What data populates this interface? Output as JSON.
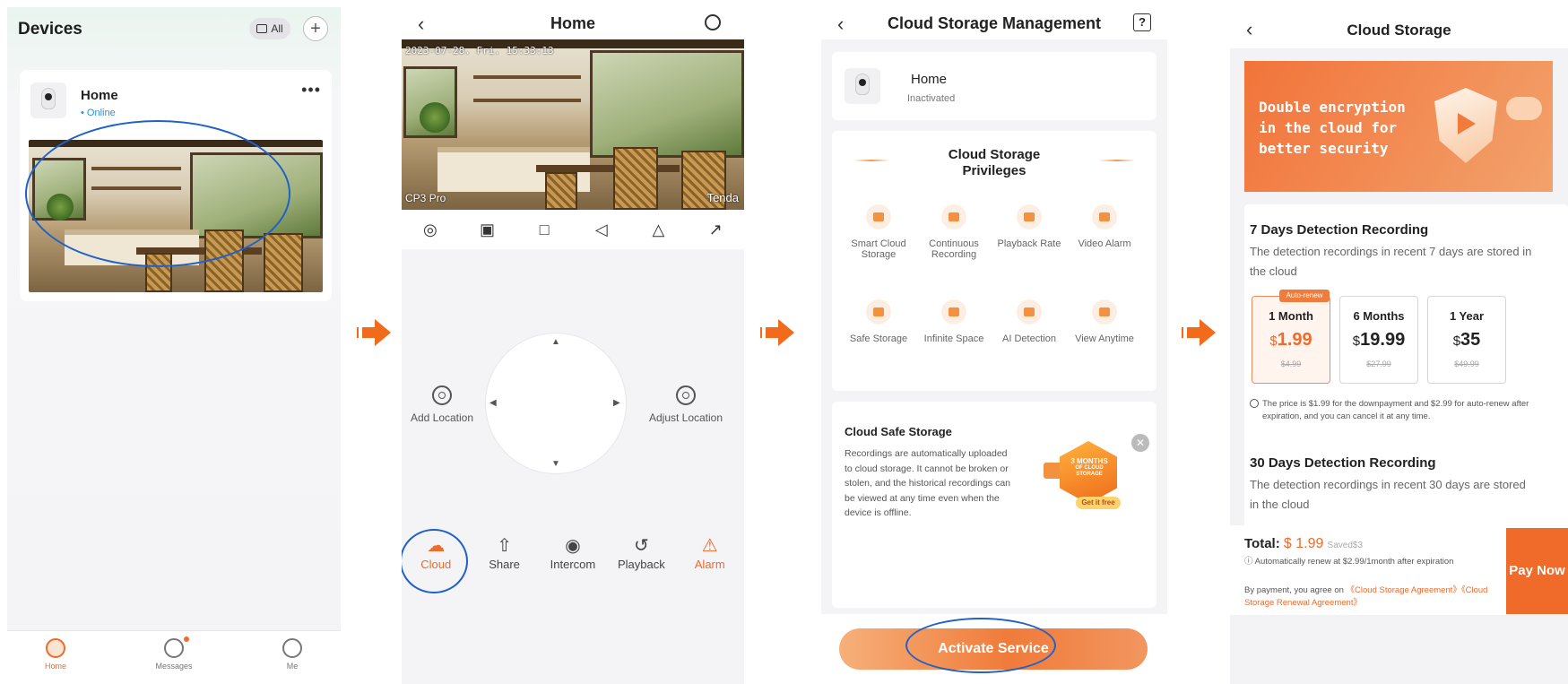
{
  "colors": {
    "accent": "#f06a2a",
    "online": "#2d8fdc",
    "highlight_ellipse": "#1f61c6"
  },
  "screen1": {
    "title": "Devices",
    "filter_label": "All",
    "device": {
      "name": "Home",
      "status": "• Online"
    },
    "tabs": [
      {
        "label": "Home",
        "icon": "home-camera-icon",
        "active": true
      },
      {
        "label": "Messages",
        "icon": "chat-icon",
        "active": false
      },
      {
        "label": "Me",
        "icon": "person-icon",
        "active": false
      }
    ]
  },
  "screen2": {
    "title": "Home",
    "timestamp": "2023-07-28. Fri.   15:33:13",
    "model": "CP3 Pro",
    "brand": "Tenda",
    "ptz_left": {
      "label": "Add Location"
    },
    "ptz_right": {
      "label": "Adjust Location"
    },
    "actions": [
      {
        "label": "Cloud",
        "icon": "cloud-icon",
        "color": "#f06a2a"
      },
      {
        "label": "Share",
        "icon": "share-icon",
        "color": "#444444"
      },
      {
        "label": "Intercom",
        "icon": "microphone-icon",
        "color": "#444444"
      },
      {
        "label": "Playback",
        "icon": "playback-icon",
        "color": "#444444"
      },
      {
        "label": "Alarm",
        "icon": "alarm-icon",
        "color": "#f06a2a"
      }
    ]
  },
  "screen3": {
    "title": "Cloud Storage Management",
    "device": {
      "name": "Home",
      "status": "Inactivated"
    },
    "privileges_title": "Cloud Storage Privileges",
    "privileges": [
      {
        "label": "Smart Cloud Storage",
        "icon": "cloud-storage-icon"
      },
      {
        "label": "Continuous Recording",
        "icon": "video-record-icon"
      },
      {
        "label": "Playback Rate",
        "icon": "fast-forward-icon"
      },
      {
        "label": "Video Alarm",
        "icon": "video-alarm-icon"
      },
      {
        "label": "Safe Storage",
        "icon": "shield-icon"
      },
      {
        "label": "Infinite Space",
        "icon": "box-icon"
      },
      {
        "label": "AI Detection",
        "icon": "ai-detection-icon"
      },
      {
        "label": "View Anytime",
        "icon": "view-icon"
      }
    ],
    "safe_title": "Cloud Safe Storage",
    "safe_text": "Recordings are automatically uploaded to cloud storage. It cannot be broken or stolen, and the historical recordings can be viewed at any time even when the device is offline.",
    "promo": {
      "line1": "3 MONTHS",
      "line2": "OF CLOUD STORAGE",
      "button": "Get it free"
    },
    "activate_label": "Activate Service"
  },
  "screen4": {
    "title": "Cloud Storage",
    "banner_text": "Double encryption in the cloud for better security",
    "section1": {
      "title": "7 Days Detection Recording",
      "desc": "The detection recordings in recent 7 days are stored in the cloud"
    },
    "plans": [
      {
        "tag": "Auto-renew",
        "duration": "1 Month",
        "currency": "$",
        "price": "1.99",
        "original": "$4.99",
        "selected": true
      },
      {
        "tag": "",
        "duration": "6 Months",
        "currency": "$",
        "price": "19.99",
        "original": "$27.99",
        "selected": false
      },
      {
        "tag": "",
        "duration": "1 Year",
        "currency": "$",
        "price": "35",
        "original": "$49.99",
        "selected": false
      }
    ],
    "note": "The price is $1.99 for the downpayment and $2.99 for auto-renew after expiration, and you can cancel it at any time.",
    "section2": {
      "title": "30 Days Detection Recording",
      "desc": "The detection recordings in recent 30 days are stored in the cloud"
    },
    "total_label": "Total:",
    "total_amount": "$ 1.99",
    "saved": "Saved$3",
    "renew_note": "Automatically renew at $2.99/1month after expiration",
    "agree_prefix": "By payment, you agree on ",
    "agree_link1": "《Cloud Storage Agreement》",
    "agree_link2": "《Cloud Storage Renewal Agreement》",
    "pay_label": "Pay Now"
  }
}
